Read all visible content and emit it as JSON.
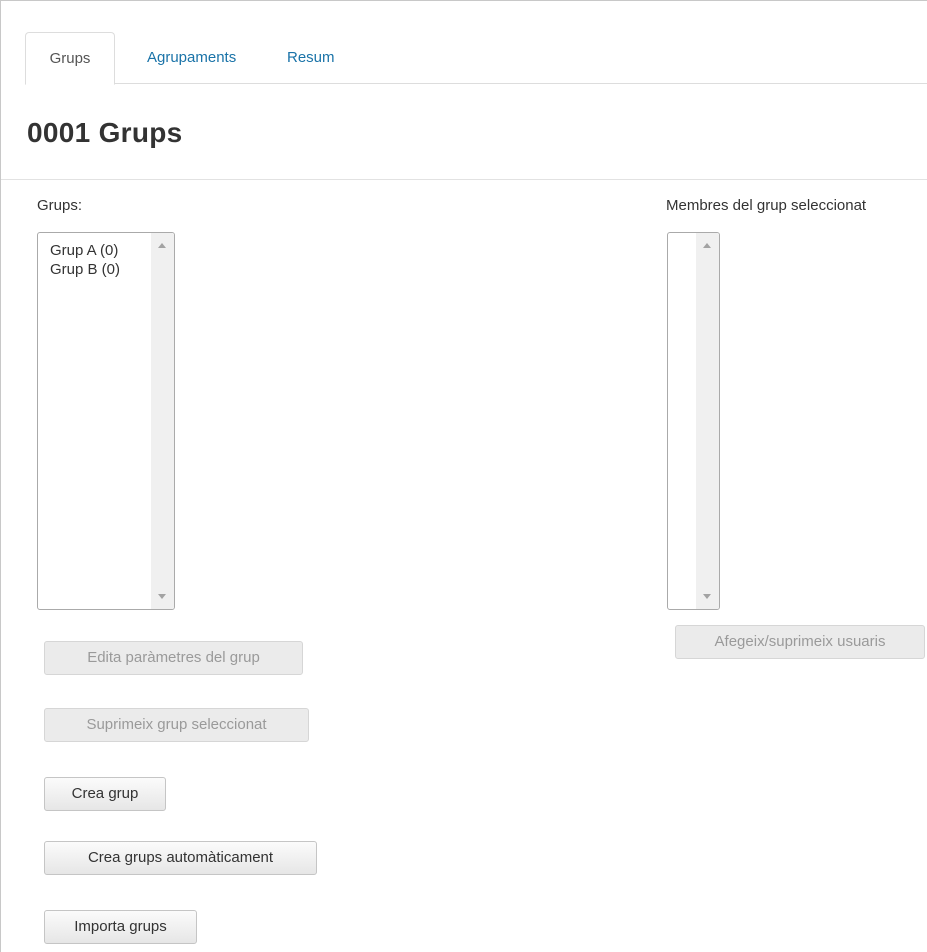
{
  "tabs": [
    {
      "label": "Grups",
      "active": true
    },
    {
      "label": "Agrupaments",
      "active": false
    },
    {
      "label": "Resum",
      "active": false
    }
  ],
  "page_title": "0001 Grups",
  "groups_panel": {
    "label": "Grups:",
    "items": [
      "Grup A (0)",
      "Grup B (0)"
    ]
  },
  "members_panel": {
    "label": "Membres del grup seleccionat",
    "items": []
  },
  "buttons": {
    "edit_group": "Edita paràmetres del grup",
    "delete_group": "Suprimeix grup seleccionat",
    "create_group": "Crea grup",
    "auto_create": "Crea grups automàticament",
    "import_groups": "Importa grups",
    "add_remove_users": "Afegeix/suprimeix usuaris"
  },
  "colors": {
    "link": "#1a73a8",
    "disabled_text": "#9a9a9a"
  }
}
